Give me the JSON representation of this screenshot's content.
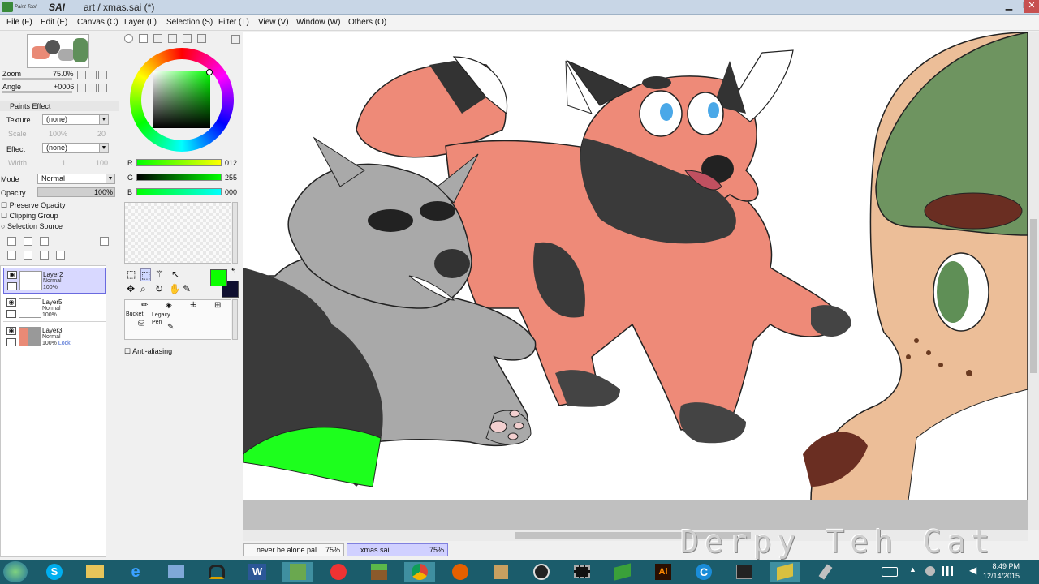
{
  "window": {
    "app_logo": "PaintTool SAI",
    "title": "art / xmas.sai (*)",
    "controls": [
      "minimize",
      "maximize",
      "close"
    ]
  },
  "menu": [
    "File (F)",
    "Edit (E)",
    "Canvas (C)",
    "Layer (L)",
    "Selection (S)",
    "Filter (T)",
    "View (V)",
    "Window (W)",
    "Others (O)"
  ],
  "navigator": {
    "zoom_label": "Zoom",
    "zoom_value": "75.0%",
    "angle_label": "Angle",
    "angle_value": "+0006"
  },
  "paints_effect": {
    "header": "Paints Effect",
    "texture_label": "Texture",
    "texture_value": "(none)",
    "scale_label": "Scale",
    "scale_value": "100%",
    "scale_num": "20",
    "effect_label": "Effect",
    "effect_value": "(none)",
    "width_label": "Width",
    "width_value": "1",
    "width_num": "100"
  },
  "layer_props": {
    "mode_label": "Mode",
    "mode_value": "Normal",
    "opacity_label": "Opacity",
    "opacity_value": "100%",
    "preserve": "Preserve Opacity",
    "clipping": "Clipping Group",
    "selection": "Selection Source"
  },
  "layers": [
    {
      "name": "Layer2",
      "mode": "Normal",
      "opacity": "100%",
      "lock": "",
      "selected": true
    },
    {
      "name": "Layer5",
      "mode": "Normal",
      "opacity": "100%",
      "lock": "",
      "selected": false
    },
    {
      "name": "Layer3",
      "mode": "Normal",
      "opacity": "100%",
      "lock": "Lock",
      "selected": false
    }
  ],
  "color": {
    "r_label": "R",
    "r_value": "012",
    "g_label": "G",
    "g_value": "255",
    "b_label": "B",
    "b_value": "000",
    "primary": "#0cff00",
    "secondary": "#101030",
    "r_level": 0.05,
    "g_level": 1.0,
    "b_level": 0.0
  },
  "tools": {
    "bucket": "Bucket",
    "legacy_pen": "Legacy Pen",
    "antialias": "Anti-aliasing"
  },
  "file_tabs": [
    {
      "name": "never be alone pal...",
      "zoom": "75%"
    },
    {
      "name": "xmas.sai",
      "zoom": "75%"
    }
  ],
  "watermark": "Derpy Teh Cat",
  "clock": {
    "time": "8:49 PM",
    "date": "12/14/2015"
  },
  "taskbar_icons": [
    "start-orb",
    "skype-icon",
    "explorer-icon",
    "ie-icon",
    "app-icon",
    "headphones-icon",
    "word-icon",
    "minecraft-icon",
    "acrobat-icon",
    "grass-block-icon",
    "chrome-icon",
    "firefox-icon",
    "tool-icon",
    "obs-icon",
    "film-icon",
    "book-icon",
    "illustrator-icon",
    "g-icon",
    "terminal-icon",
    "sai-book-icon",
    "brush-icon"
  ]
}
